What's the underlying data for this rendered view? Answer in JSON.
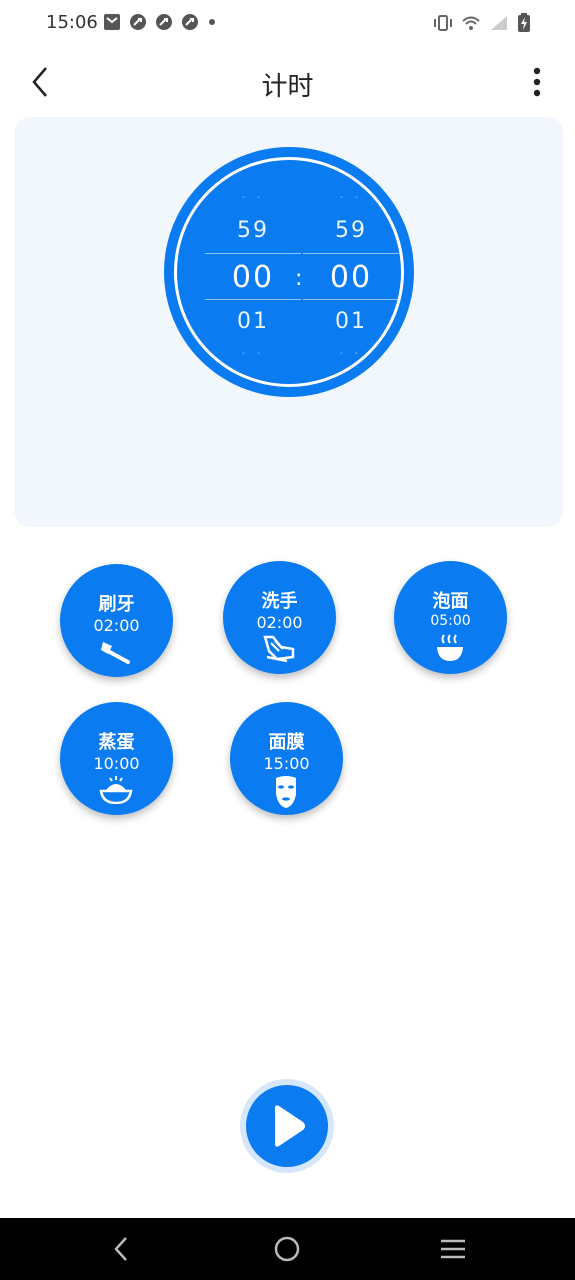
{
  "status_bar": {
    "time": "15:06",
    "left_icons": [
      "mail-icon",
      "app-icon",
      "app-icon",
      "app-icon",
      "dot-icon"
    ],
    "right_icons": [
      "vibrate-icon",
      "wifi-icon",
      "signal-icon",
      "battery-charging-icon"
    ]
  },
  "header": {
    "title": "计时",
    "back_icon": "chevron-left-icon",
    "more_icon": "more-vertical-icon"
  },
  "timer": {
    "minutes": {
      "faded_top": "- -",
      "prev": "59",
      "current": "00",
      "next": "01",
      "faded_bottom": "- -"
    },
    "seconds": {
      "faded_top": "- -",
      "prev": "59",
      "current": "00",
      "next": "01",
      "faded_bottom": "- -"
    },
    "separator": ":"
  },
  "presets": [
    {
      "label": "刷牙",
      "time": "02:00",
      "icon": "toothbrush-icon"
    },
    {
      "label": "洗手",
      "time": "02:00",
      "icon": "hand-wash-icon"
    },
    {
      "label": "泡面",
      "time": "05:00",
      "icon": "noodle-bowl-icon"
    },
    {
      "label": "蒸蛋",
      "time": "10:00",
      "icon": "steamed-egg-icon"
    },
    {
      "label": "面膜",
      "time": "15:00",
      "icon": "face-mask-icon"
    }
  ],
  "play": {
    "icon": "play-icon"
  },
  "nav_bar": {
    "icons": [
      "nav-back-icon",
      "nav-home-icon",
      "nav-menu-icon"
    ]
  },
  "colors": {
    "accent": "#0a7bf0",
    "panel_bg": "#f2f6fd",
    "play_halo": "#d6e7fb"
  }
}
